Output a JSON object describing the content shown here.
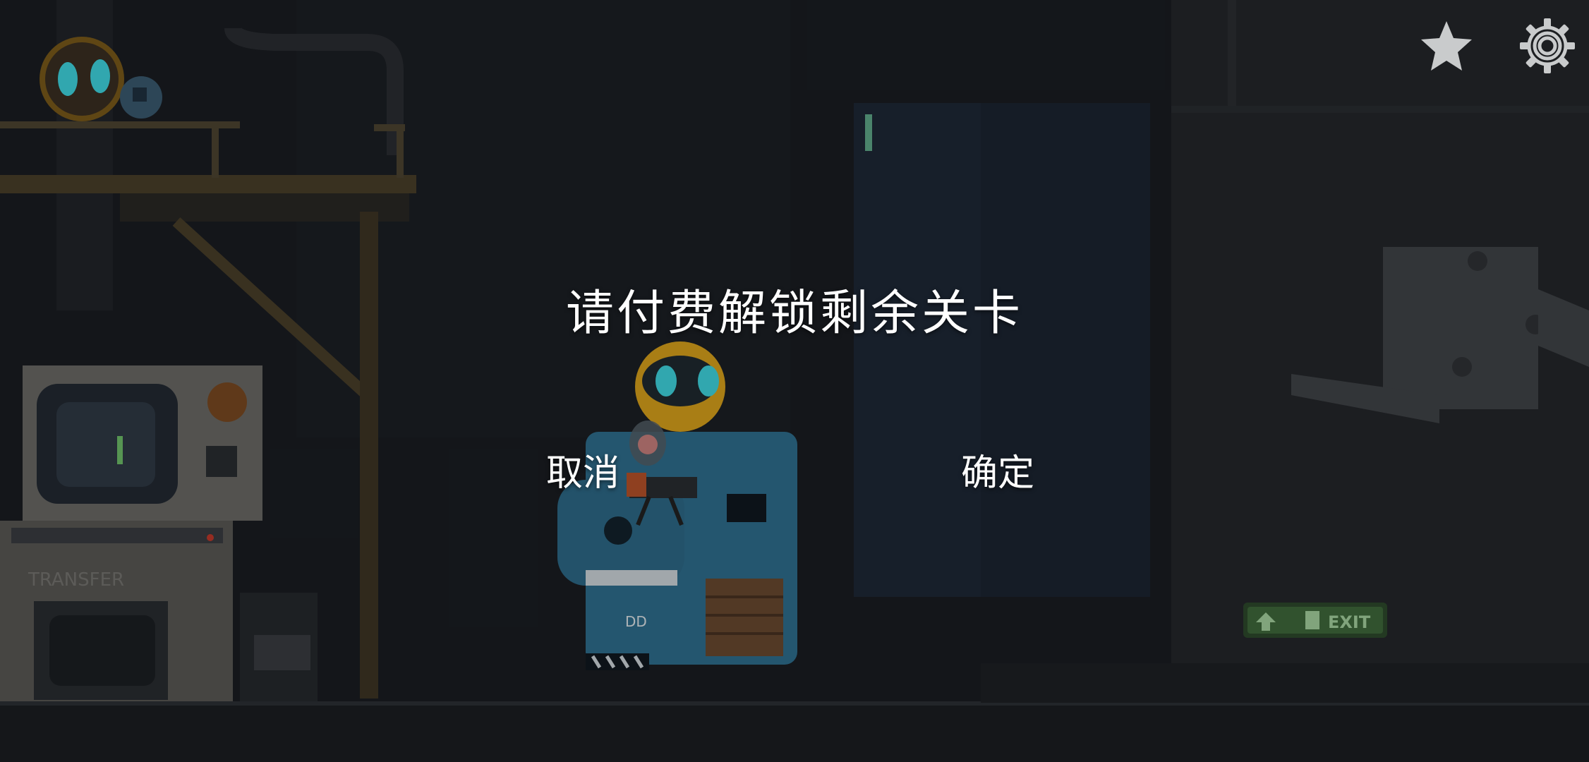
{
  "dialog": {
    "title": "请付费解锁剩余关卡",
    "cancel_label": "取消",
    "confirm_label": "确定"
  },
  "top_bar": {
    "favorite_icon": "star-icon",
    "settings_icon": "gear-icon"
  },
  "scene": {
    "exit_sign_text": "EXIT",
    "terminal_stencil_text": "TRANSFER",
    "machine_label_text": "DD"
  },
  "colors": {
    "robot_eye": "#3fd6e0",
    "robot_shell": "#d9a21c",
    "machine_blue": "#2f6f8f",
    "exit_green": "#6fbf6a",
    "dialog_text": "#ffffff"
  }
}
